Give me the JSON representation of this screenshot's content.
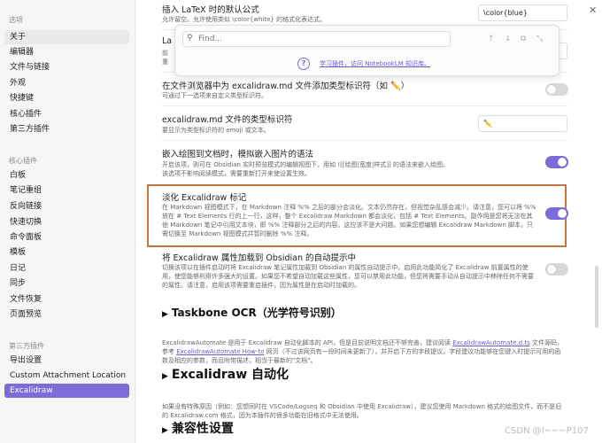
{
  "sidebar": {
    "top_items": [
      {
        "label": "选项",
        "type": "header"
      },
      {
        "label": "关于",
        "type": "item"
      },
      {
        "label": "编辑器",
        "type": "item"
      },
      {
        "label": "文件与链接",
        "type": "item"
      },
      {
        "label": "外观",
        "type": "item"
      },
      {
        "label": "快捷键",
        "type": "item"
      },
      {
        "label": "核心插件",
        "type": "item"
      },
      {
        "label": "第三方插件",
        "type": "item"
      }
    ],
    "core_header": "核心插件",
    "core_items": [
      "白板",
      "笔记重组",
      "反向链接",
      "快速切换",
      "命令面板",
      "模板",
      "日记",
      "同步",
      "文件恢复",
      "页面预览"
    ],
    "third_header": "第三方插件",
    "third_items": [
      "导出设置",
      "Custom Attachment Location",
      "Excalidraw"
    ]
  },
  "find_bar": {
    "placeholder": "Find...",
    "help_link": "学习插件，访问 NotebookLM 知识库。"
  },
  "settings": [
    {
      "title": "插入 LaTeX 时的默认公式",
      "desc": "允许留空。允许使用类似 \\color{white} 的格式化表达式。",
      "value": "\\color{blue}"
    },
    {
      "title": "La",
      "desc": "前",
      "desc2": "重"
    },
    {
      "title": "在文件浏览器中为 excalidraw.md 文件添加类型标识符（如 ✏️）",
      "desc": "可通过下一选项来自定义类型标识符。"
    },
    {
      "title": "excalidraw.md 文件的类型标识符",
      "desc": "要显示为类型标识符的 emoji 或文本。",
      "value": "✏️"
    },
    {
      "title": "嵌入绘图到文档时，模拟嵌入图片的语法",
      "desc": "开启该项，则可在 Obsidian 实时预览模式的编辑视图下，用如 ![[绘图|宽度|样式]] 的语法来嵌入绘图。",
      "desc2": "该选项不影响阅读模式，需要重新打开来使设置生效。"
    },
    {
      "title": "淡化 Excalidraw 标记",
      "desc": "在 Markdown 视图模式下，在 Markdown 注释 %% 之后的部分会淡化。文本仍然存在，但视觉杂乱感会减少。请注意，您可以将 %% 放在 # Text Elements 行的上一行，这样，整个 Excalidraw Markdown 都会淡化，包括 # Text Elements。副作用是您将无法在其他 Markdown 笔记中引用文本块，即 %% 注释部分之后的内容。这应该不是大问题。如果您想编辑 Excalidraw Markdown 脚本，只需切换至 Markdown 视图模式并暂时删除 %% 注释。"
    },
    {
      "title": "将 Excalidraw 属性加载到 Obsidian 的自动提示中",
      "desc": "切换该项以在插件启动时将 Excalidraw 笔记属性加载到 Obsidian 的属性自动提示中。启用此功能简化了 Excalidraw 前置属性的使用，使您能够利用许多强大的设置。如果您不希望自动加载这些属性，您可以禁用此功能，但您将需要手动从自动提示中移除任何不需要的属性。请注意，启用该项需要重启插件，因为属性是在启动时加载的。"
    }
  ],
  "toggles": {
    "filetag": false,
    "embed": true,
    "fade": true,
    "autoload": false
  },
  "sections": {
    "ocr": "Taskbone OCR（光学符号识别）",
    "automate_text1": "ExcalidrawAutomate 是用于 Excalidraw 自动化脚本的 API，但是目前说明文档还不够完善，建议阅读 ",
    "automate_link1": "ExcalidrawAutomate.d.ts",
    "automate_text2": " 文件源码，参考 ",
    "automate_link2": "ExcalidrawAutomate How-to",
    "automate_text3": " 网页（不过该网页有一段时间未更新了），并开启下方的字段提议。字段建议功能够在您键入时提示可用的函数及相应的参数，而且附带描述，相当于最新的\"文档\"。",
    "automate": "Excalidraw 自动化",
    "compat_desc": "如果没有特殊原因（例如：您想同时在 VSCode/Logseq 和 Obsidian 中使用 Excalidraw），建议您使用 Markdown 格式的绘图文件，而不是旧的 Excalidraw.com 格式，因为本插件的很多功能在旧格式中无法使用。",
    "compat": "兼容性设置"
  },
  "watermark": "CSDN @I~~~P107",
  "colors": {
    "accent": "#7b6cd9",
    "highlight": "#c9733e"
  }
}
